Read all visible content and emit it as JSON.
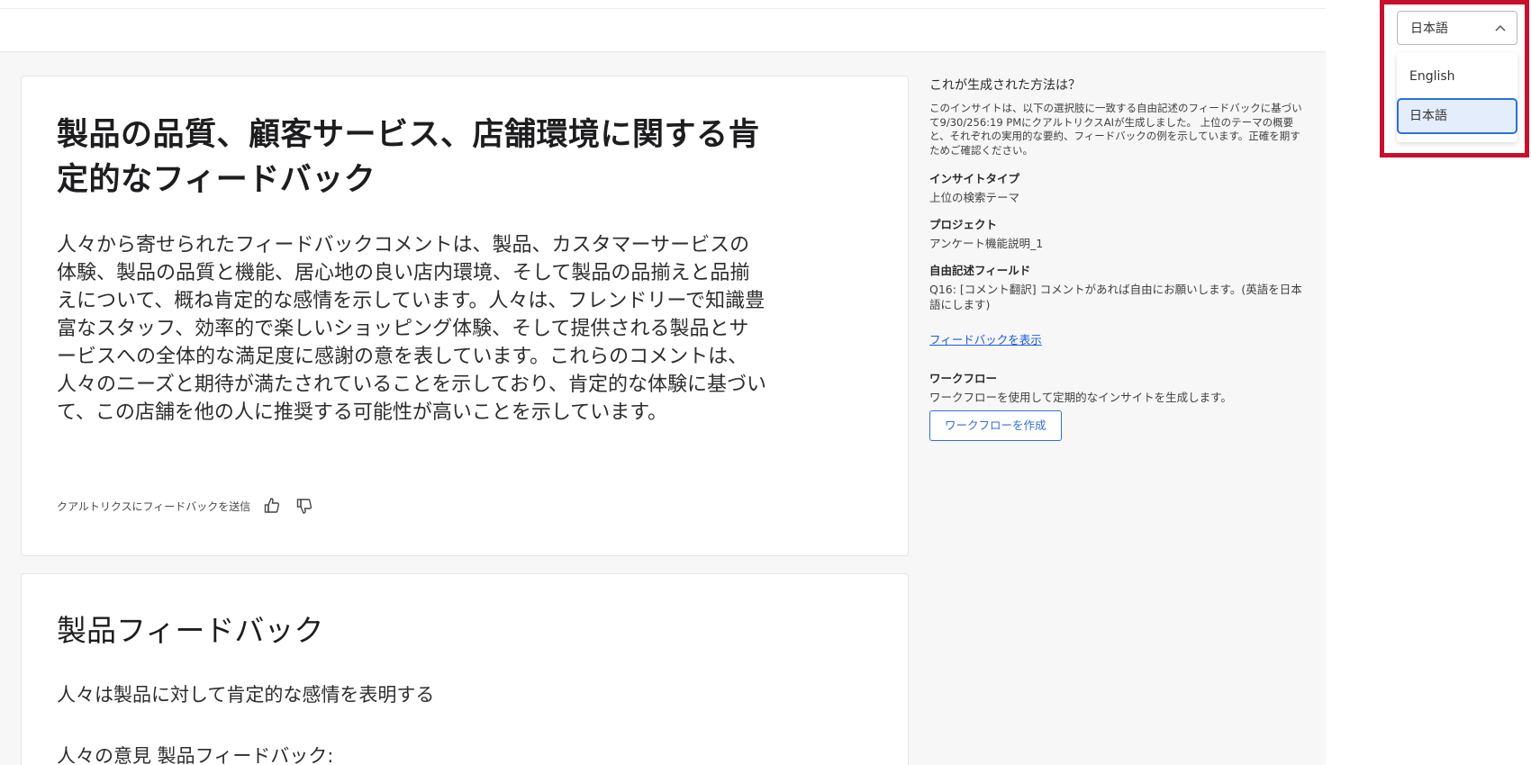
{
  "insight": {
    "headline": "製品の品質、顧客サービス、店舗環境に関する肯定的なフィードバック",
    "summary": "人々から寄せられたフィードバックコメントは、製品、カスタマーサービスの体験、製品の品質と機能、居心地の良い店内環境、そして製品の品揃えと品揃えについて、概ね肯定的な感情を示しています。人々は、フレンドリーで知識豊富なスタッフ、効率的で楽しいショッピング体験、そして提供される製品とサービスへの全体的な満足度に感謝の意を表しています。これらのコメントは、人々のニーズと期待が満たされていることを示しており、肯定的な体験に基づいて、この店舗を他の人に推奨する可能性が高いことを示しています。",
    "feedback_label": "クアルトリクスにフィードバックを送信"
  },
  "theme_card": {
    "title": "製品フィードバック",
    "line1": "人々は製品に対して肯定的な感情を表明する",
    "line2": "人々の意見 製品フィードバック:"
  },
  "sidebar": {
    "heading": "これが生成された方法は？",
    "description": "このインサイトは、以下の選択肢に一致する自由記述のフィードバックに基づいて9/30/256:19 PMにクアルトリクスAIが生成しました。 上位のテーマの概要と、それぞれの実用的な要約、フィードバックの例を示しています。正確を期すためご確認ください。",
    "insight_type_label": "インサイトタイプ",
    "insight_type_value": "上位の検索テーマ",
    "project_label": "プロジェクト",
    "project_value": "アンケート機能説明_1",
    "field_label": "自由記述フィールド",
    "field_value": "Q16: [コメント翻訳] コメントがあれば自由にお願いします。(英語を日本語にします)",
    "view_feedback_link": "フィードバックを表示",
    "workflow_label": "ワークフロー",
    "workflow_desc": "ワークフローを使用して定期的なインサイトを生成します。",
    "workflow_button": "ワークフローを作成"
  },
  "language": {
    "selected": "日本語",
    "options": [
      "English",
      "日本語"
    ]
  },
  "colors": {
    "accent": "#2f6fd6",
    "highlight": "#c8102e"
  }
}
